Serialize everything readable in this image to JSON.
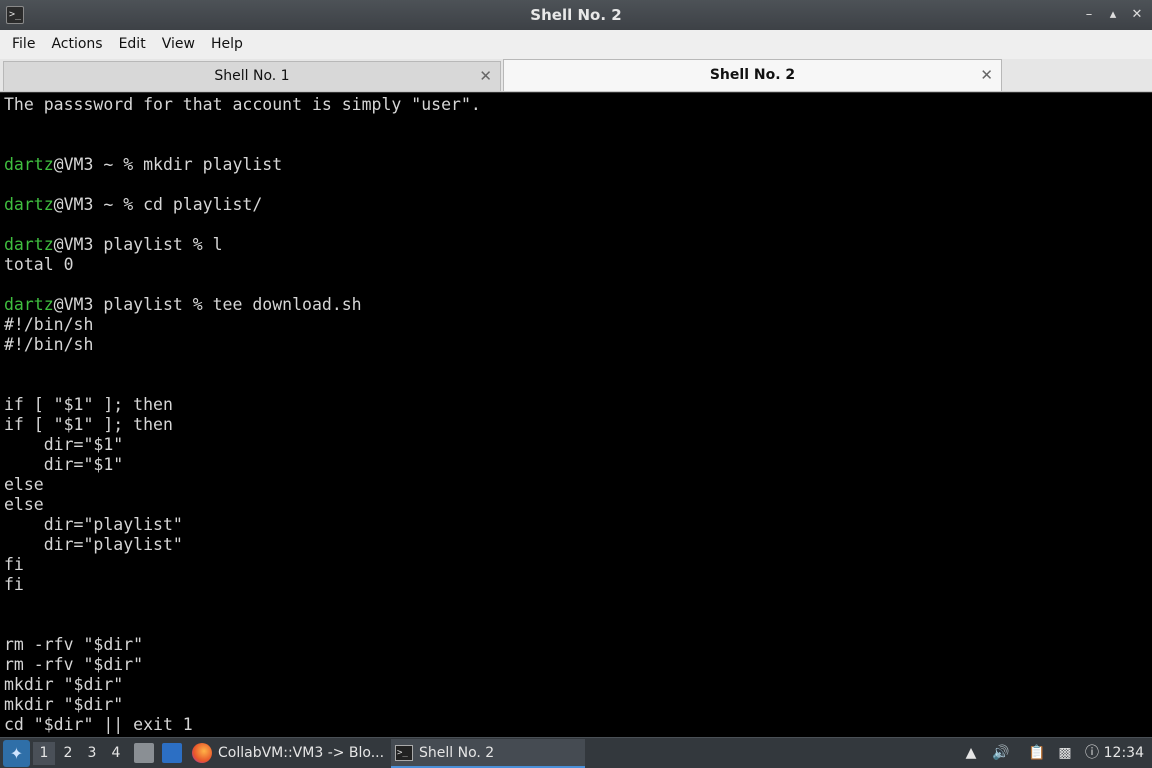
{
  "window": {
    "title": "Shell No. 2",
    "buttons": [
      "minimize-icon",
      "maximize-icon",
      "close-icon"
    ]
  },
  "menu": [
    "File",
    "Actions",
    "Edit",
    "View",
    "Help"
  ],
  "tabs": [
    {
      "label": "Shell No. 1",
      "active": false
    },
    {
      "label": "Shell No. 2",
      "active": true
    }
  ],
  "terminal": {
    "lines": [
      "The passsword for that account is simply \"user\".",
      "",
      "",
      "dartz@VM3 ~ % mkdir playlist",
      "",
      "dartz@VM3 ~ % cd playlist/",
      "",
      "dartz@VM3 playlist % l",
      "total 0",
      "",
      "dartz@VM3 playlist % tee download.sh",
      "#!/bin/sh",
      "#!/bin/sh",
      "",
      "",
      "if [ \"$1\" ]; then",
      "if [ \"$1\" ]; then",
      "    dir=\"$1\"",
      "    dir=\"$1\"",
      "else",
      "else",
      "    dir=\"playlist\"",
      "    dir=\"playlist\"",
      "fi",
      "fi",
      "",
      "",
      "rm -rfv \"$dir\"",
      "rm -rfv \"$dir\"",
      "mkdir \"$dir\"",
      "mkdir \"$dir\"",
      "cd \"$dir\" || exit 1"
    ],
    "prompt_user": "dartz",
    "colors": {
      "user": "#3fbf3f",
      "text": "#d6d6d6",
      "background": "#000000"
    }
  },
  "taskbar": {
    "desktops": [
      "1",
      "2",
      "3",
      "4"
    ],
    "active_desktop": "1",
    "tasks": [
      {
        "label": "CollabVM::VM3 -> Blo...",
        "icon": "firefox-icon"
      },
      {
        "label": "Shell No. 2",
        "icon": "terminal-icon",
        "active": true
      }
    ],
    "clock": "12:34"
  }
}
